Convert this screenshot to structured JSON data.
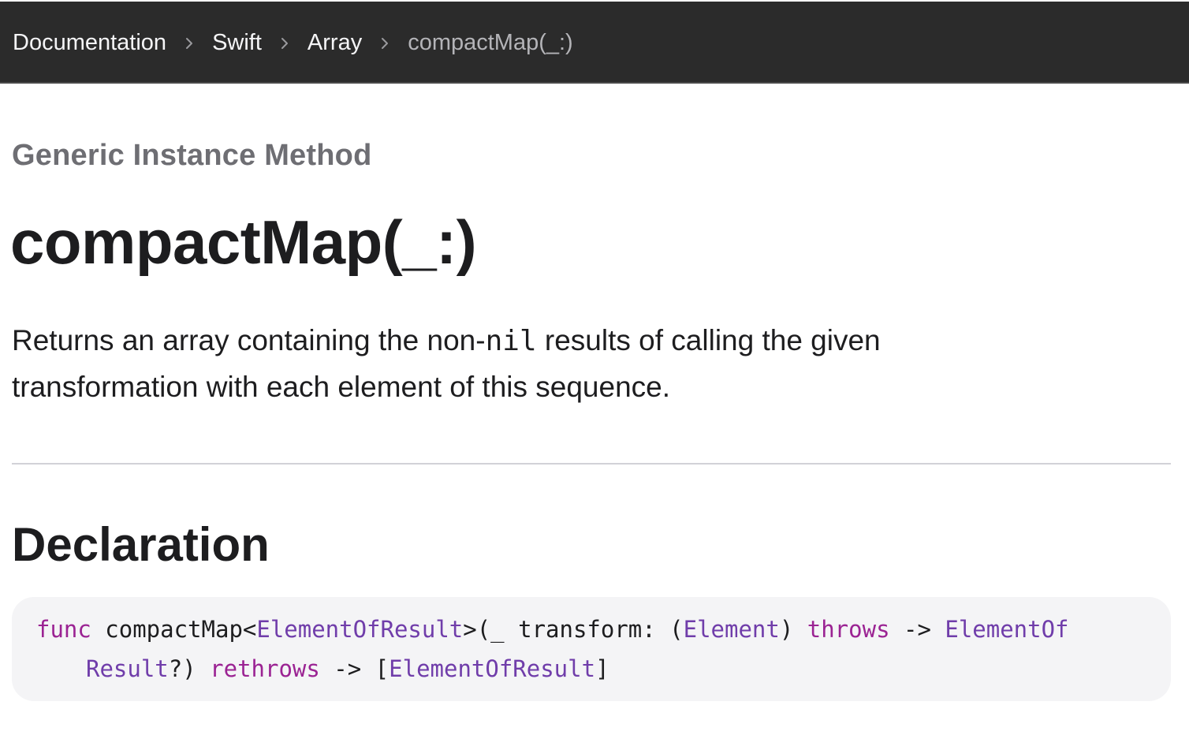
{
  "breadcrumb": {
    "items": [
      "Documentation",
      "Swift",
      "Array"
    ],
    "current": "compactMap(_:)"
  },
  "header": {
    "eyebrow": "Generic Instance Method",
    "title": "compactMap(_:)"
  },
  "abstract": {
    "part1": "Returns an array containing the non-",
    "code": "nil",
    "part2": " results of calling the given transformation with each element of this sequence."
  },
  "declaration": {
    "heading": "Declaration",
    "tokens_line1": {
      "func": "func",
      "name": " compactMap<",
      "generic": "ElementOfResult",
      "open": ">(_ transform: (",
      "param_type": "Element",
      "close": ") ",
      "throws": "throws",
      "arrow": " -> ",
      "ret_part1": "ElementOf"
    },
    "tokens_line2": {
      "ret_part2": "Result",
      "optional": "?) ",
      "rethrows": "rethrows",
      "arrow": " -> [",
      "result_type": "ElementOfResult",
      "end": "]"
    }
  },
  "colors": {
    "topbar": "#2b2b2b",
    "keyword": "#9b2393",
    "type": "#703daa",
    "code_background": "#f4f4f6"
  }
}
